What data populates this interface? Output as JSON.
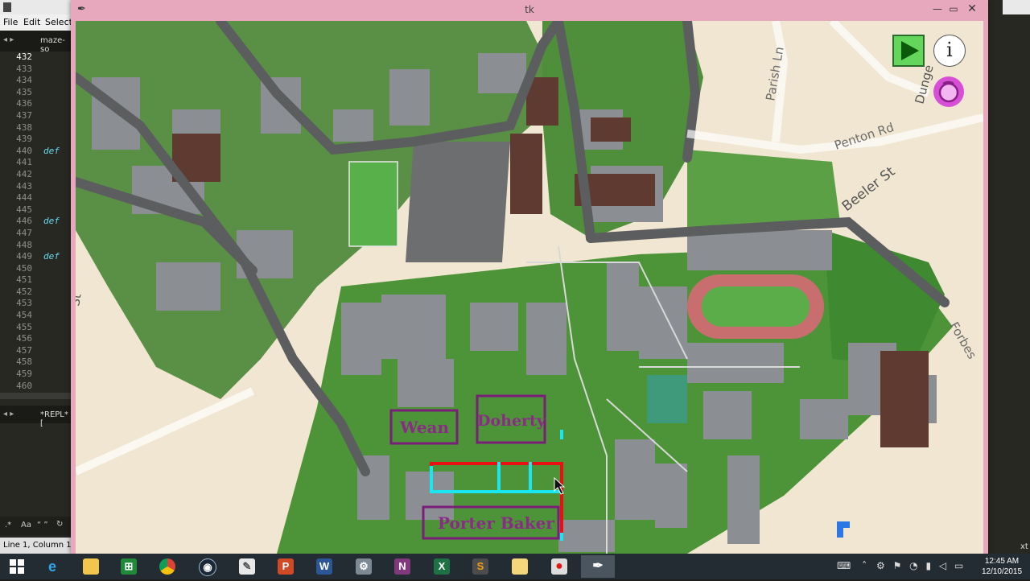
{
  "editor": {
    "menu": [
      "File",
      "Edit",
      "Selecti"
    ],
    "tab_label": "maze-so",
    "line_numbers": [
      "432",
      "433",
      "434",
      "435",
      "436",
      "437",
      "438",
      "439",
      "440",
      "441",
      "442",
      "443",
      "444",
      "445",
      "446",
      "447",
      "448",
      "449",
      "450",
      "451",
      "452",
      "453",
      "454",
      "455",
      "456",
      "457",
      "458",
      "459",
      "460"
    ],
    "code_keywords": [
      "def",
      "def",
      "def"
    ],
    "repl_tab": "*REPL* [",
    "find_case": "Aa",
    "find_quote": "“ ”",
    "status": "Line 1, Column 1",
    "right_fragment": "xt"
  },
  "tk": {
    "title": "tk",
    "feather_icon": "feather-icon"
  },
  "map": {
    "streets": [
      "Parish Ln",
      "Penton Rd",
      "Beeler St",
      "Forbes",
      "Dunge",
      "St"
    ],
    "buildings": [
      "Wean",
      "Doherty",
      "Porter Baker"
    ],
    "colors": {
      "route_red": "#e81010",
      "route_cyan": "#19e6f0",
      "building_box": "#7b1e7a",
      "grass": "#4e9a3a",
      "road": "#5e5e5e"
    }
  },
  "controls": {
    "play_icon": "play-icon",
    "info_label": "i",
    "reset_icon": "reset-icon"
  },
  "taskbar": {
    "apps": [
      "start-icon",
      "internet-explorer-icon",
      "file-explorer-icon",
      "excel-store-icon",
      "chrome-icon",
      "steam-icon",
      "paint-icon",
      "powerpoint-icon",
      "word-icon",
      "tool-icon",
      "onenote-icon",
      "excel-icon",
      "sublime-icon",
      "folder-icon",
      "record-icon",
      "feather-app-icon"
    ],
    "time": "12:45 AM",
    "date": "12/10/2015"
  }
}
